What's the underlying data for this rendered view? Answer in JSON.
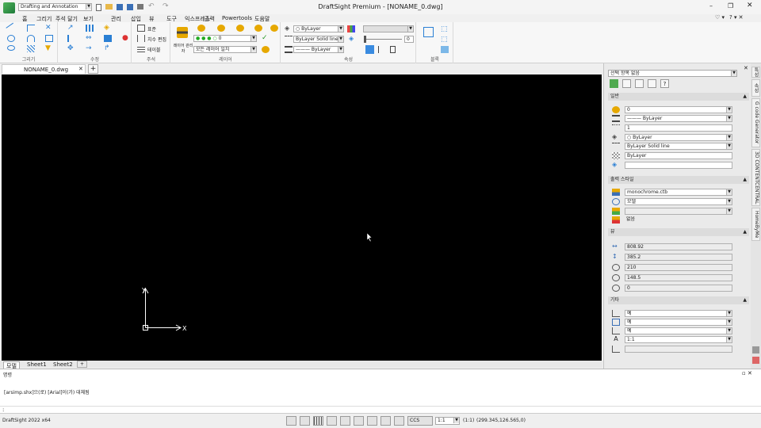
{
  "window": {
    "title": "DraftSight Premium - [NONAME_0.dwg]",
    "workspace": "Drafting and Annotation"
  },
  "ribbon": {
    "tabs": [
      "홈",
      "그리기",
      "주석 달기",
      "보기",
      "관리",
      "삽입",
      "뷰",
      "도구",
      "익스프레스",
      "출력",
      "Powertools",
      "도움말"
    ],
    "groups": {
      "draw": "그리기",
      "modify": "수정",
      "annotate": "주석",
      "layers": "레이어",
      "properties": "속성",
      "view": "뷰",
      "block": "블록"
    },
    "layer_combo": "0",
    "color_combo": "ByLayer",
    "linestyle_combo": "ByLayer     Solid line",
    "lineweight_combo": "——— ByLayer",
    "transparency_value": "0",
    "text_btn1": "표준",
    "text_btn2": "치수 편집",
    "text_btn3": "테이블",
    "layer_btn": "레이어 관리자",
    "layer_filter": "모든 레이어 일치"
  },
  "doc_tabs": [
    {
      "label": "NONAME_0.dwg"
    }
  ],
  "layout_tabs": [
    "모델",
    "Sheet1",
    "Sheet2"
  ],
  "canvas": {
    "ucs_x": "X",
    "ucs_y": "Y",
    "background": "#000000"
  },
  "command": {
    "header": "명령",
    "history": "[arsimp.shx]으(로) [Arial]이(가) 대체됨",
    "prompt": ":"
  },
  "status": {
    "version": "DraftSight 2022 x64",
    "ccs": "CCS",
    "scale_combo": "1:1",
    "annotation_scale": "(1:1)",
    "coords": "(299.345,126.565,0)"
  },
  "props": {
    "selector": "선택 항목 없음",
    "sections": {
      "general": "일반",
      "plot": "출력 스타일",
      "view": "뷰",
      "misc": "기타"
    },
    "general": {
      "layer": "0",
      "lineweight": "——— ByLayer",
      "scale": "1",
      "color": "○ ByLayer",
      "linestyle": "ByLayer     Solid line",
      "transparency": "ByLayer",
      "hyperlink": ""
    },
    "plot": {
      "style_table": "monochrome.ctb",
      "attached_to": "모델",
      "style": "",
      "mode": "없음"
    },
    "view": {
      "width": "808.92",
      "height": "385.2",
      "center_x": "210",
      "center_y": "148.5",
      "center_z": "0"
    },
    "misc": {
      "ucs_on": "예",
      "ucs_origin": "예",
      "ucs_per_view": "예",
      "scale": "1:1",
      "ucs_name": ""
    }
  },
  "vertical_tabs": [
    "HomeByMe",
    "3D CONTENTCENTRAL",
    "G code Generator",
    "속성",
    "특성"
  ],
  "colors": {
    "accent": "#4a8fd8",
    "canvas": "#000000",
    "panel": "#eaeaea"
  }
}
